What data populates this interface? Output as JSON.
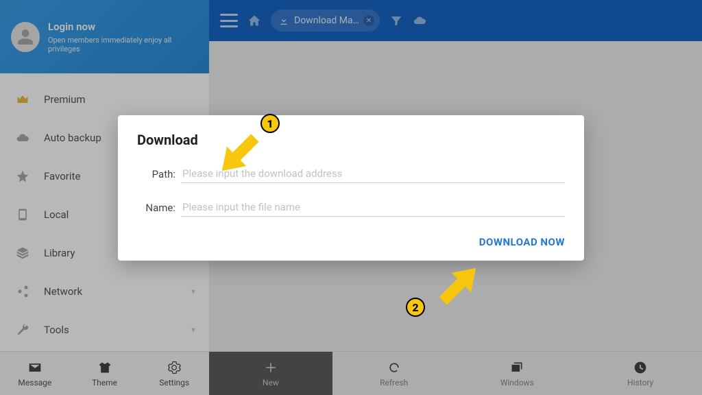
{
  "colors": {
    "accent": "#2676d6",
    "annotation": "#f6c70d",
    "sidebarHeader": "#3b9fe8"
  },
  "header": {
    "login_title": "Login now",
    "login_sub": "Open members immediately enjoy all privileges"
  },
  "sidebar": {
    "items": [
      {
        "label": "Premium",
        "icon": "crown"
      },
      {
        "label": "Auto backup",
        "icon": "cloud"
      },
      {
        "label": "Favorite",
        "icon": "star"
      },
      {
        "label": "Local",
        "icon": "phone"
      },
      {
        "label": "Library",
        "icon": "stack"
      },
      {
        "label": "Network",
        "icon": "share",
        "expandable": true
      },
      {
        "label": "Tools",
        "icon": "wrench",
        "expandable": true
      }
    ]
  },
  "topbar": {
    "breadcrumb": "Download Ma…"
  },
  "bottom_left": {
    "items": [
      {
        "label": "Message"
      },
      {
        "label": "Theme"
      },
      {
        "label": "Settings"
      }
    ]
  },
  "bottom_right": {
    "items": [
      {
        "label": "New"
      },
      {
        "label": "Refresh"
      },
      {
        "label": "Windows"
      },
      {
        "label": "History"
      }
    ]
  },
  "dialog": {
    "title": "Download",
    "path_label": "Path:",
    "path_placeholder": "Please input the download address",
    "name_label": "Name:",
    "name_placeholder": "Please input the file name",
    "action": "DOWNLOAD NOW"
  },
  "annotations": {
    "step1": "1",
    "step2": "2"
  }
}
